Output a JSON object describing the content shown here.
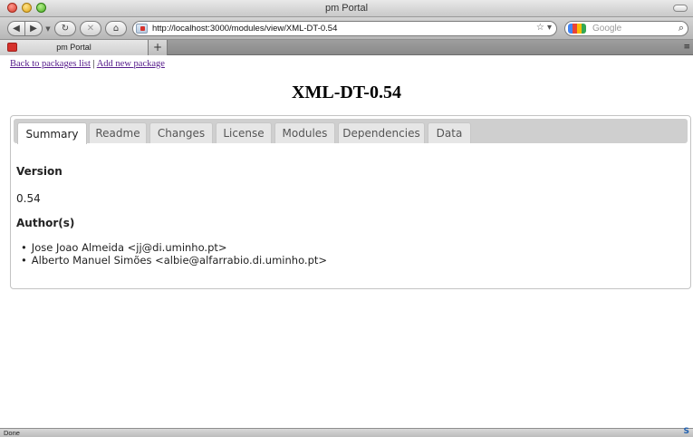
{
  "window": {
    "title": "pm Portal"
  },
  "toolbar": {
    "url": "http://localhost:3000/modules/view/XML-DT-0.54",
    "search_placeholder": "Google"
  },
  "browser_tabs": [
    {
      "label": "pm Portal"
    }
  ],
  "page": {
    "nav_back": "Back to packages list",
    "nav_sep": "|",
    "nav_add": "Add new package",
    "title": "XML-DT-0.54"
  },
  "tabs": [
    {
      "label": "Summary",
      "active": true
    },
    {
      "label": "Readme"
    },
    {
      "label": "Changes"
    },
    {
      "label": "License"
    },
    {
      "label": "Modules"
    },
    {
      "label": "Dependencies"
    },
    {
      "label": "Data"
    }
  ],
  "summary": {
    "version_heading": "Version",
    "version": "0.54",
    "authors_heading": "Author(s)",
    "authors": [
      "Jose Joao Almeida <jj@di.uminho.pt>",
      "Alberto Manuel Simões <albie@alfarrabio.di.uminho.pt>"
    ]
  },
  "status": {
    "text": "Done"
  }
}
